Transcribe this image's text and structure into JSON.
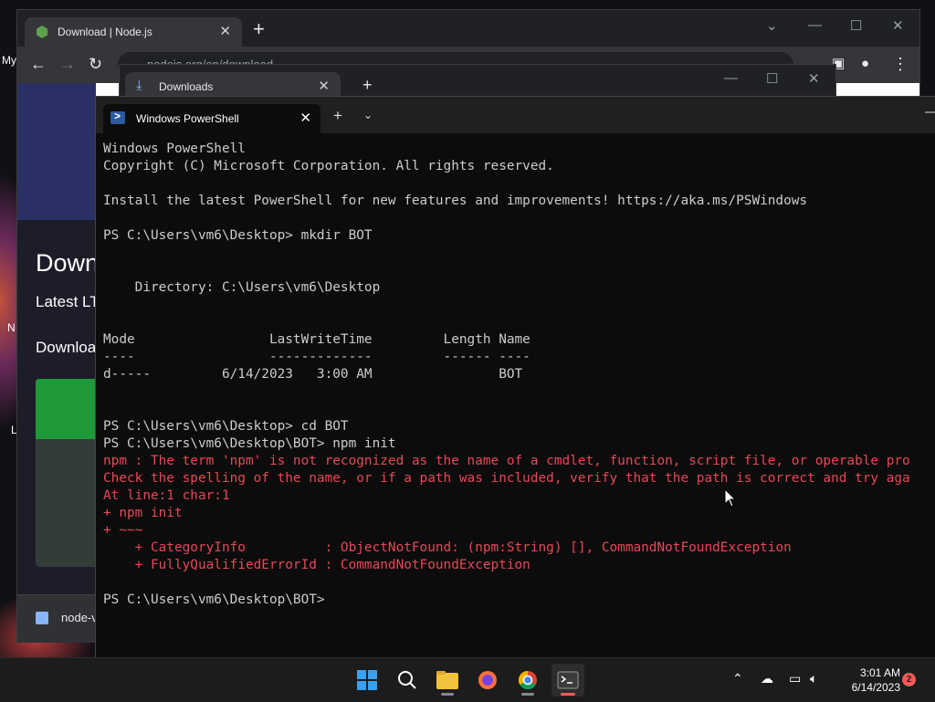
{
  "desktop": {
    "left_label_1": "My",
    "left_label_2": "N",
    "left_label_3": "L"
  },
  "chrome": {
    "tab_title": "Download | Node.js",
    "url": "nodejs.org/en/download",
    "page": {
      "heading": "Down",
      "latest": "Latest LT",
      "download": "Downloa"
    },
    "download_bar_item": "node-v"
  },
  "downloads_window": {
    "tab_title": "Downloads"
  },
  "terminal": {
    "tab_title": "Windows PowerShell",
    "lines": [
      {
        "text": "Windows PowerShell",
        "kind": "out"
      },
      {
        "text": "Copyright (C) Microsoft Corporation. All rights reserved.",
        "kind": "out"
      },
      {
        "text": "",
        "kind": "out"
      },
      {
        "text": "Install the latest PowerShell for new features and improvements! https://aka.ms/PSWindows",
        "kind": "out"
      },
      {
        "text": "",
        "kind": "out"
      },
      {
        "text": "PS C:\\Users\\vm6\\Desktop> mkdir BOT",
        "kind": "prompt"
      },
      {
        "text": "",
        "kind": "out"
      },
      {
        "text": "",
        "kind": "out"
      },
      {
        "text": "    Directory: C:\\Users\\vm6\\Desktop",
        "kind": "out"
      },
      {
        "text": "",
        "kind": "out"
      },
      {
        "text": "",
        "kind": "out"
      },
      {
        "text": "Mode                 LastWriteTime         Length Name",
        "kind": "out"
      },
      {
        "text": "----                 -------------         ------ ----",
        "kind": "out"
      },
      {
        "text": "d-----         6/14/2023   3:00 AM                BOT",
        "kind": "out"
      },
      {
        "text": "",
        "kind": "out"
      },
      {
        "text": "",
        "kind": "out"
      },
      {
        "text": "PS C:\\Users\\vm6\\Desktop> cd BOT",
        "kind": "prompt"
      },
      {
        "text": "PS C:\\Users\\vm6\\Desktop\\BOT> npm init",
        "kind": "prompt"
      },
      {
        "text": "npm : The term 'npm' is not recognized as the name of a cmdlet, function, script file, or operable pro",
        "kind": "err"
      },
      {
        "text": "Check the spelling of the name, or if a path was included, verify that the path is correct and try aga",
        "kind": "err"
      },
      {
        "text": "At line:1 char:1",
        "kind": "err"
      },
      {
        "text": "+ npm init",
        "kind": "err"
      },
      {
        "text": "+ ~~~",
        "kind": "err"
      },
      {
        "text": "    + CategoryInfo          : ObjectNotFound: (npm:String) [], CommandNotFoundException",
        "kind": "err"
      },
      {
        "text": "    + FullyQualifiedErrorId : CommandNotFoundException",
        "kind": "err"
      },
      {
        "text": "",
        "kind": "out"
      },
      {
        "text": "PS C:\\Users\\vm6\\Desktop\\BOT>",
        "kind": "prompt"
      }
    ]
  },
  "taskbar": {
    "time": "3:01 AM",
    "date": "6/14/2023",
    "notification_count": "2",
    "apps": [
      "start-icon",
      "search-icon",
      "file-explorer-icon",
      "firefox-icon",
      "chrome-icon",
      "terminal-icon"
    ]
  },
  "colors": {
    "terminal_error": "#e74856",
    "node_green": "#1e9a3a",
    "powershell_blue": "#2c5aa0"
  }
}
